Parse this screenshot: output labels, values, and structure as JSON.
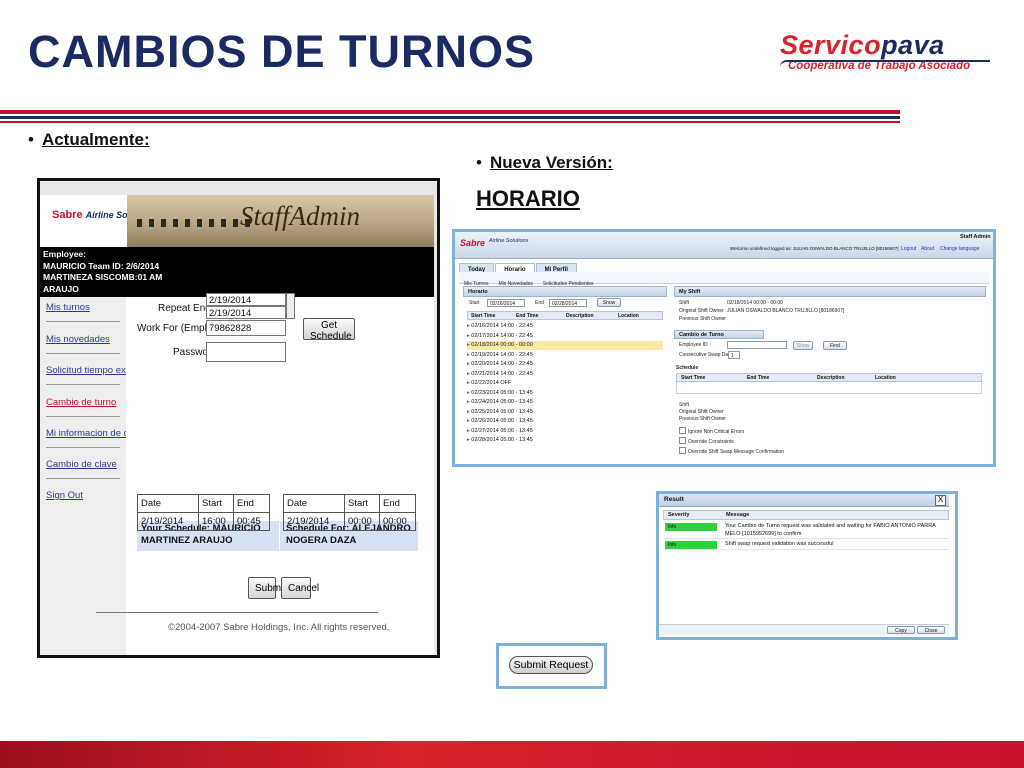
{
  "slide": {
    "title": "CAMBIOS DE TURNOS",
    "logo_brand_red": "Servico",
    "logo_brand_blue": "pava",
    "logo_tagline": "Cooperativa de Trabajo Asociado",
    "bullet_current": "Actualmente:",
    "bullet_new": "Nueva Versión:",
    "horario_heading": "HORARIO",
    "colors": {
      "title": "#1c2a63",
      "brand_red": "#d9232a",
      "stripe_red": "#c8102e",
      "stripe_blue": "#1c2a63"
    }
  },
  "old_app": {
    "brand": "Sabre",
    "brand_sub": "Airline Solutions",
    "product": "StaffAdmin",
    "employee_info": [
      "Employee:",
      "MAURICIO Team ID: 2/6/2014",
      "MARTINEZA SISCOMB:01 AM",
      "ARAUJO"
    ],
    "menu": [
      "Mis turnos",
      "Mis novedades",
      "Solicitud tiempo extra",
      "Cambio de turno",
      "Mi informacion de contacto",
      "Cambio de clave",
      "Sign Out"
    ],
    "active_menu_index": 3,
    "form": {
      "repeat_end_label": "Repeat End Date:",
      "repeat_end_value": "2/19/2014",
      "repeat_end_value_2": "2/19/2014",
      "work_for_label": "Work For (Employee ID):",
      "work_for_value": "79862828",
      "password_label": "Password:",
      "get_schedule": "Get Schedule"
    },
    "your_schedule_label": "Your Schedule: MAURICIO MARTINEZ ARAUJO",
    "schedule_for_label": "Schedule For: ALEJANDRO NOGERA DAZA",
    "table_headers": [
      "Date",
      "Start",
      "End"
    ],
    "your_row": [
      "2/19/2014",
      "16:00",
      "00:45"
    ],
    "for_row": [
      "2/19/2014",
      "00:00",
      "00:00"
    ],
    "submit": "Submit",
    "cancel": "Cancel",
    "copyright": "©2004-2007 Sabre Holdings, Inc. All rights reserved."
  },
  "new_app": {
    "brand": "Sabre",
    "brand_sub": "Airline Solutions",
    "app_name": "Staff Admin",
    "welcome": "Welcome undefined logged as: JULIAN OSWALDO BLANCO TRUJILLO [80186907]",
    "logout": "Logout",
    "about": "About",
    "change_language": "Change language",
    "tabs": [
      "Today",
      "Horario",
      "Mi Perfil"
    ],
    "active_tab_index": 1,
    "subtabs": [
      "Mis Turnos",
      "Mis Novedades",
      "Solicitudes Pendientes"
    ],
    "horario_pane": {
      "title": "Horario",
      "start_label": "Start",
      "start_value": "02/16/2014",
      "end_label": "End",
      "end_value": "02/28/2014",
      "show": "Show",
      "columns": [
        "Start Time",
        "End Time",
        "Description",
        "Location"
      ],
      "rows": [
        "02/16/2014 14:00 - 22:45",
        "02/17/2014 14:00 - 22:45",
        "02/18/2014 00:00 - 00:00",
        "02/19/2014 14:00 - 22:45",
        "02/20/2014 14:00 - 22:45",
        "02/21/2014 14:00 - 22:45",
        "02/22/2014 OFF",
        "02/23/2014 05:00 - 13:45",
        "02/24/2014 05:00 - 13:45",
        "02/25/2014 05:00 - 13:45",
        "02/26/2014 05:00 - 13:45",
        "02/27/2014 05:00 - 13:45",
        "02/28/2014 05:00 - 13:45"
      ],
      "selected_row_index": 2
    },
    "my_shift_pane": {
      "title": "My Shift",
      "shift_label": "Shift",
      "shift_value": "02/18/2014 00:00 - 00:00",
      "orig_owner_label": "Original Shift Owner",
      "orig_owner_value": "JULIAN OSWALDO BLANCO TRUJILLO [80186907]",
      "prev_owner_label": "Previous Shift Owner",
      "cambio_title": "Cambio de Turno",
      "employee_id_label": "Employee ID",
      "show": "Show",
      "find": "Find",
      "consec_label": "Consecutive Swap Days",
      "consec_value": "1",
      "schedule_title": "Schedule",
      "columns": [
        "Start Time",
        "End Time",
        "Description",
        "Location"
      ],
      "shift2_label": "Shift",
      "orig_owner2_label": "Original Shift Owner",
      "prev_owner2_label": "Previous Shift Owner",
      "checks": [
        "Ignore Non Critical Errors",
        "Override Constraints",
        "Override Shift Swap Message Confirmation"
      ]
    }
  },
  "result_dialog": {
    "title": "Result",
    "close": "X",
    "col_severity": "Severity",
    "col_message": "Message",
    "rows": [
      {
        "severity": "Info",
        "message": "Your Cambio de Turno request was validated and waiting for FABIO ANTONIO PARRA MELO [1015992699] to confirm"
      },
      {
        "severity": "Info",
        "message": "Shift swap request validation was successful"
      }
    ],
    "copy": "Copy",
    "close_btn": "Close",
    "severity_color": "#2fd13a"
  },
  "submit_request": "Submit Request"
}
